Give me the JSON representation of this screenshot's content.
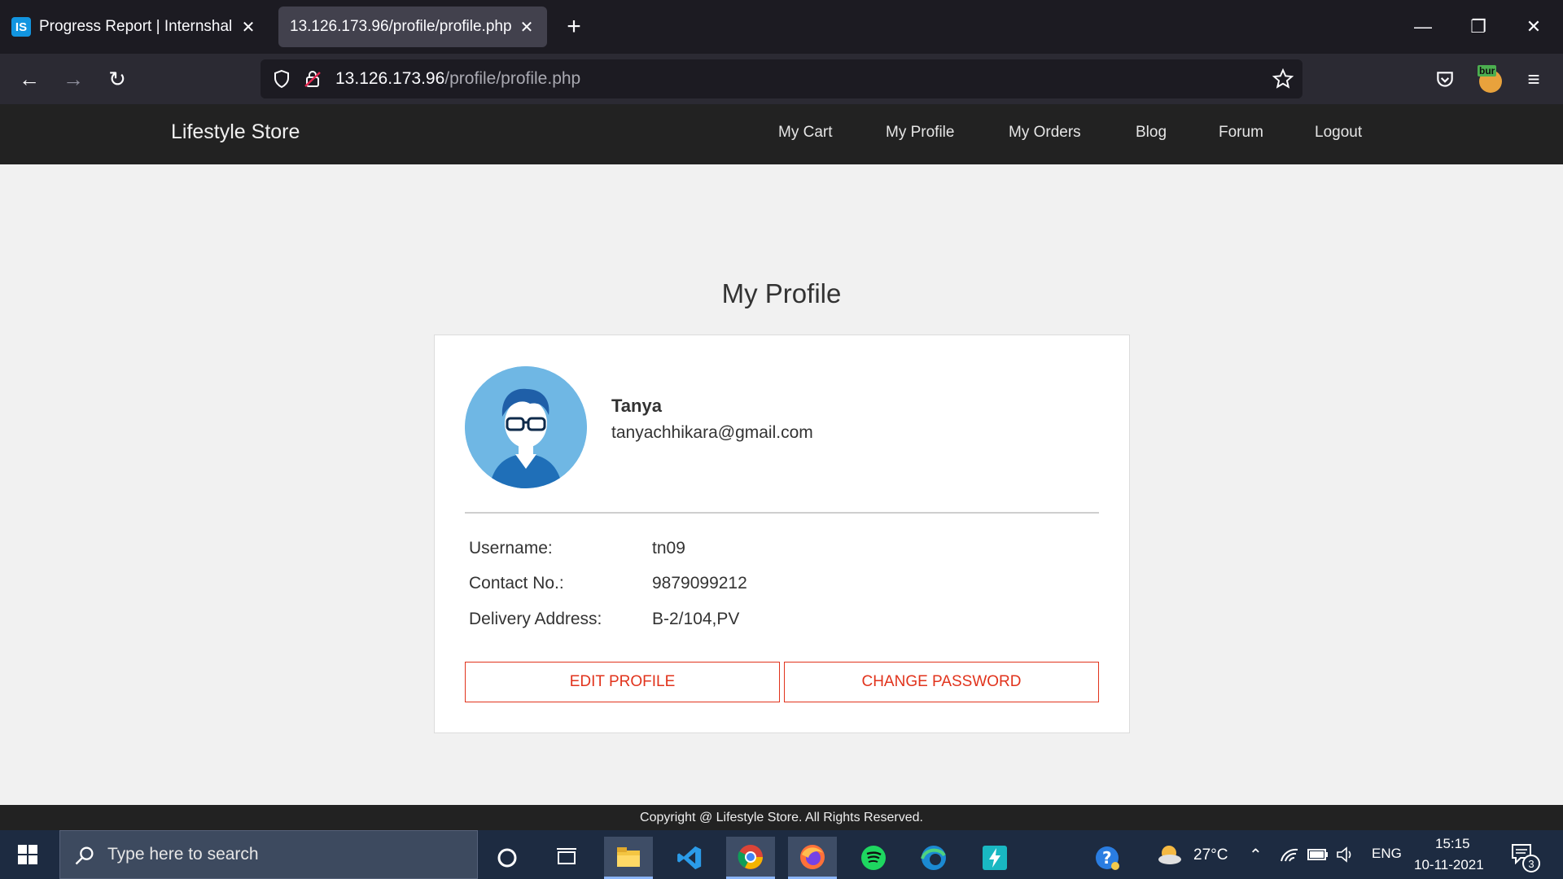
{
  "browser": {
    "tabs": [
      {
        "title": "Progress Report | Internshala Tra",
        "favicon": "IS",
        "active": false
      },
      {
        "title": "13.126.173.96/profile/profile.php",
        "active": true
      }
    ],
    "url_host": "13.126.173.96",
    "url_path": "/profile/profile.php",
    "extension_badge": "bur"
  },
  "site": {
    "brand": "Lifestyle Store",
    "nav": [
      "My Cart",
      "My Profile",
      "My Orders",
      "Blog",
      "Forum",
      "Logout"
    ]
  },
  "profile": {
    "page_title": "My Profile",
    "name": "Tanya",
    "email": "tanyachhikara@gmail.com",
    "details": [
      {
        "label": "Username:",
        "value": "tn09"
      },
      {
        "label": "Contact No.:",
        "value": "9879099212"
      },
      {
        "label": "Delivery Address:",
        "value": "B-2/104,PV"
      }
    ],
    "edit_button": "EDIT PROFILE",
    "password_button": "CHANGE PASSWORD"
  },
  "footer": {
    "copyright": "Copyright @ Lifestyle Store. All Rights Reserved."
  },
  "taskbar": {
    "search_placeholder": "Type here to search",
    "temperature": "27°C",
    "language": "ENG",
    "time": "15:15",
    "date": "10-11-2021",
    "notification_count": "3"
  },
  "colors": {
    "accent": "#e1331c",
    "header_bg": "#222222",
    "avatar_bg": "#6fb7e4"
  }
}
